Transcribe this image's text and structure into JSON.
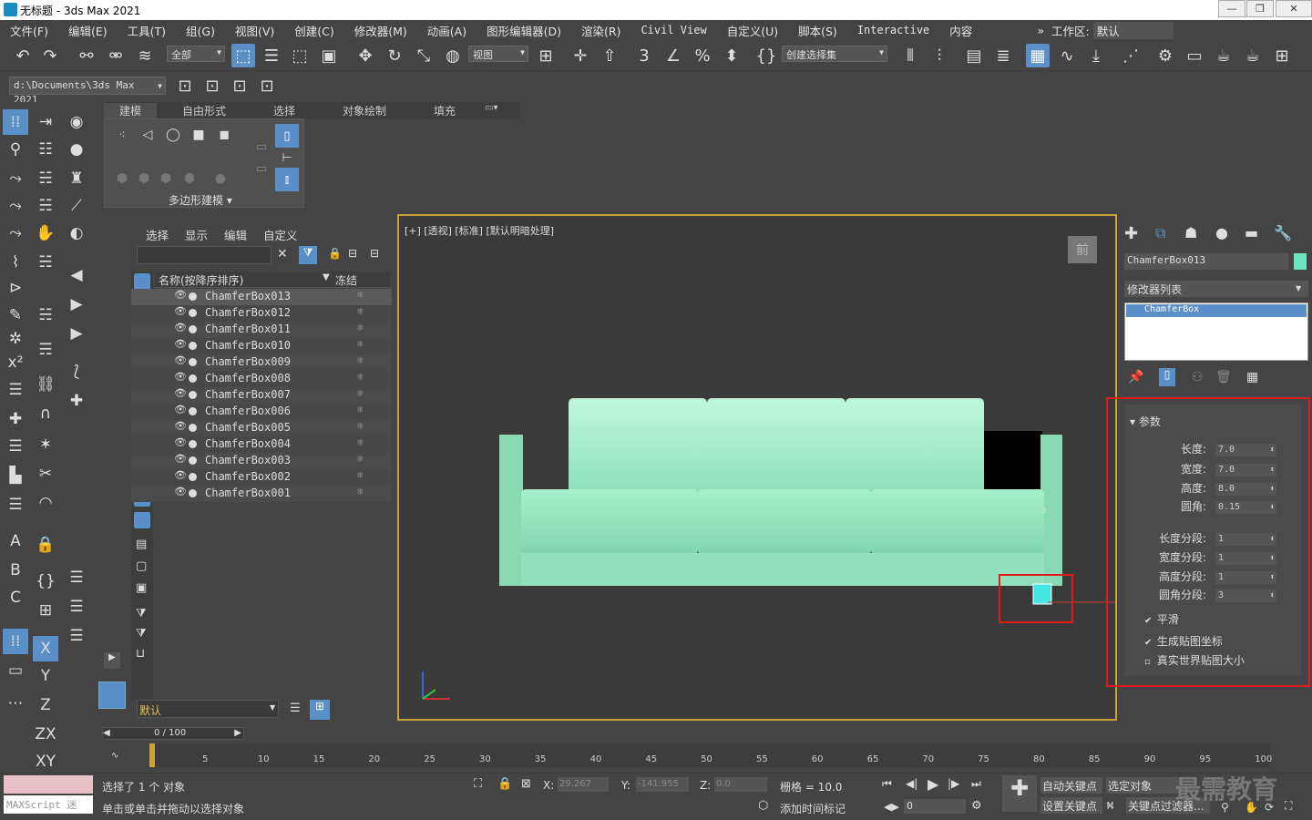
{
  "title": "无标题 - 3ds Max 2021",
  "window": {
    "min": "—",
    "max": "❐",
    "close": "✕"
  },
  "menu": [
    "文件(F)",
    "编辑(E)",
    "工具(T)",
    "组(G)",
    "视图(V)",
    "创建(C)",
    "修改器(M)",
    "动画(A)",
    "图形编辑器(D)",
    "渲染(R)",
    "Civil View",
    "自定义(U)",
    "脚本(S)",
    "Interactive",
    "内容"
  ],
  "workspace": {
    "label": "工作区:",
    "value": "默认",
    "expand": "»"
  },
  "toolbar": {
    "filter": "全部",
    "refcoord": "视图",
    "selset": "创建选择集",
    "path": "d:\\Documents\\3ds Max 2021"
  },
  "ribbon": {
    "tabs": [
      "建模",
      "自由形式",
      "选择",
      "对象绘制",
      "填充"
    ],
    "group": "多边形建模 ▾"
  },
  "scene_explorer": {
    "menu": [
      "选择",
      "显示",
      "编辑",
      "自定义"
    ],
    "col_name": "名称(按降序排序)",
    "col_freeze": "冻结",
    "items": [
      "ChamferBox013",
      "ChamferBox012",
      "ChamferBox011",
      "ChamferBox010",
      "ChamferBox009",
      "ChamferBox008",
      "ChamferBox007",
      "ChamferBox006",
      "ChamferBox005",
      "ChamferBox004",
      "ChamferBox003",
      "ChamferBox002",
      "ChamferBox001"
    ],
    "layer": "默认"
  },
  "viewport": {
    "label": "[+] [透视] [标准] [默认明暗处理]",
    "viewcube": "前"
  },
  "command_panel": {
    "object_name": "ChamferBox013",
    "modifier_list": "修改器列表",
    "stack_item": "ChamferBox",
    "rollout": "参数",
    "params": [
      {
        "label": "长度:",
        "value": "7.0"
      },
      {
        "label": "宽度:",
        "value": "7.0"
      },
      {
        "label": "高度:",
        "value": "8.0"
      },
      {
        "label": "圆角:",
        "value": "0.15"
      }
    ],
    "segments": [
      {
        "label": "长度分段:",
        "value": "1"
      },
      {
        "label": "宽度分段:",
        "value": "1"
      },
      {
        "label": "高度分段:",
        "value": "1"
      },
      {
        "label": "圆角分段:",
        "value": "3"
      }
    ],
    "checks": [
      {
        "label": "平滑",
        "checked": true
      },
      {
        "label": "生成贴图坐标",
        "checked": true
      },
      {
        "label": "真实世界贴图大小",
        "checked": false
      }
    ]
  },
  "timeline": {
    "slider": "0 / 100",
    "ticks": [
      "5",
      "10",
      "15",
      "20",
      "25",
      "30",
      "35",
      "40",
      "45",
      "50",
      "55",
      "60",
      "65",
      "70",
      "75",
      "80",
      "85",
      "90",
      "95",
      "100"
    ]
  },
  "status": {
    "maxscript": "MAXScript 迷",
    "selected": "选择了 1 个 对象",
    "prompt": "单击或单击并拖动以选择对象",
    "x_label": "X:",
    "x": "29.267",
    "y_label": "Y:",
    "y": "-141.955",
    "z_label": "Z:",
    "z": "0.0",
    "grid": "栅格 = 10.0",
    "addtime": "添加时间标记",
    "autokey": "自动关键点",
    "selobj": "选定对象",
    "setkey": "设置关键点",
    "keyfilter": "关键点过滤器...",
    "frame": "0",
    "watermark": "最需教育"
  }
}
